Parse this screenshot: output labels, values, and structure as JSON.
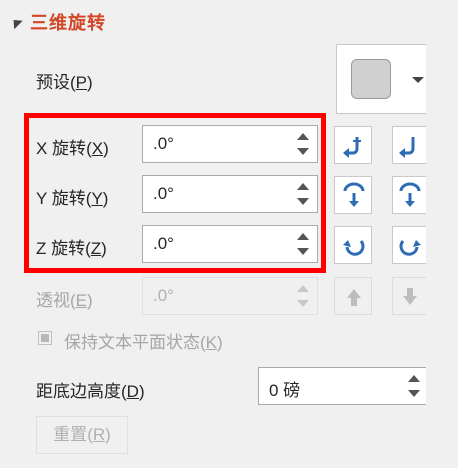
{
  "section": {
    "title": "三维旋转"
  },
  "preset": {
    "label": "预设",
    "accel": "P",
    "swatch_color": "#d0d0d0"
  },
  "x_rotation": {
    "label": "X 旋转",
    "accel": "X",
    "value": ".0°"
  },
  "y_rotation": {
    "label": "Y 旋转",
    "accel": "Y",
    "value": ".0°"
  },
  "z_rotation": {
    "label": "Z 旋转",
    "accel": "Z",
    "value": ".0°"
  },
  "perspective": {
    "label": "透视",
    "accel": "E",
    "value": ".0°",
    "enabled": false
  },
  "keep_text_flat": {
    "label": "保持文本平面状态",
    "accel": "K",
    "checked": false,
    "enabled": false
  },
  "distance_from_ground": {
    "label": "距底边高度",
    "accel": "D",
    "value": "0 磅"
  },
  "reset_button": {
    "label": "重置",
    "accel": "R",
    "enabled": false
  },
  "colors": {
    "accent_title": "#d24726",
    "highlight_box": "#ff0000",
    "icon_blue": "#2e6db4"
  }
}
